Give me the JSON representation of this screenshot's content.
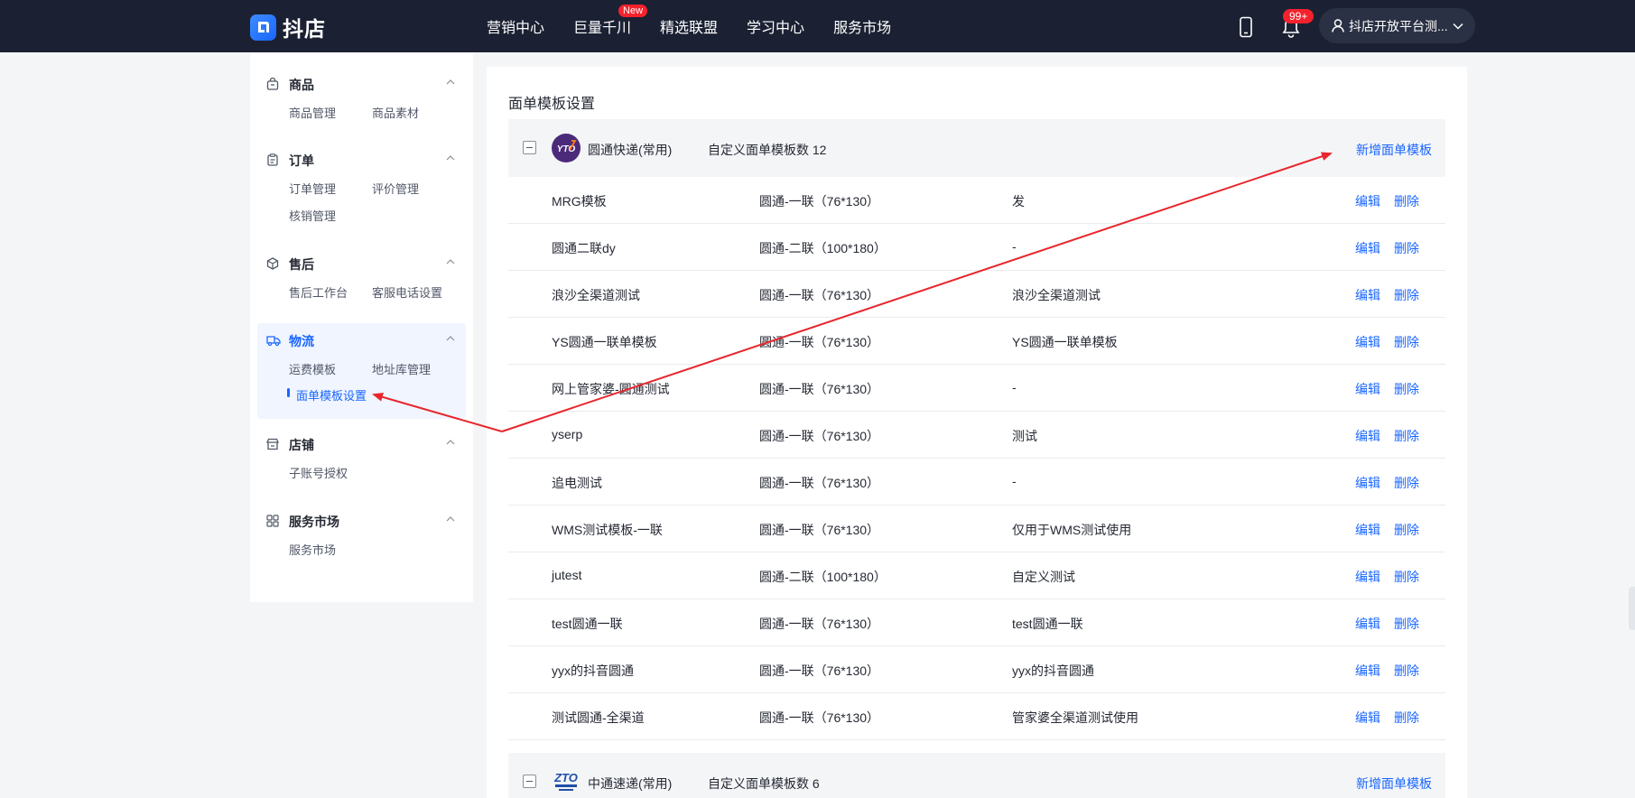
{
  "brand": {
    "name": "抖店"
  },
  "nav": [
    {
      "label": "营销中心"
    },
    {
      "label": "巨量千川",
      "badge": "New"
    },
    {
      "label": "精选联盟"
    },
    {
      "label": "学习中心"
    },
    {
      "label": "服务市场"
    }
  ],
  "header": {
    "bell_badge": "99+",
    "user_name": "抖店开放平台测..."
  },
  "sidebar": {
    "groups": [
      {
        "title": "商品",
        "icon": "bag-icon",
        "items": [
          "商品管理",
          "商品素材"
        ]
      },
      {
        "title": "订单",
        "icon": "clipboard-icon",
        "items": [
          "订单管理",
          "评价管理",
          "核销管理"
        ]
      },
      {
        "title": "售后",
        "icon": "package-icon",
        "items": [
          "售后工作台",
          "客服电话设置"
        ]
      },
      {
        "title": "物流",
        "icon": "truck-icon",
        "items": [
          "运费模板",
          "地址库管理",
          "面单模板设置"
        ],
        "active": true
      },
      {
        "title": "店铺",
        "icon": "store-icon",
        "items": [
          "子账号授权"
        ]
      },
      {
        "title": "服务市场",
        "icon": "grid-icon",
        "items": [
          "服务市场"
        ]
      }
    ]
  },
  "main": {
    "title": "面单模板设置",
    "carriers": [
      {
        "name": "圆通快递(常用)",
        "logo": "YTO",
        "count_label": "自定义面单模板数 12",
        "add_label": "新增面单模板",
        "templates": [
          {
            "name": "MRG模板",
            "type": "圆通-一联（76*130）",
            "remark": "发"
          },
          {
            "name": "圆通二联dy",
            "type": "圆通-二联（100*180）",
            "remark": "-"
          },
          {
            "name": "浪沙全渠道测试",
            "type": "圆通-一联（76*130）",
            "remark": "浪沙全渠道测试"
          },
          {
            "name": "YS圆通一联单模板",
            "type": "圆通-一联（76*130）",
            "remark": "YS圆通一联单模板"
          },
          {
            "name": "网上管家婆-圆通测试",
            "type": "圆通-一联（76*130）",
            "remark": "-"
          },
          {
            "name": "yserp",
            "type": "圆通-一联（76*130）",
            "remark": "测试"
          },
          {
            "name": "追电测试",
            "type": "圆通-一联（76*130）",
            "remark": "-"
          },
          {
            "name": "WMS测试模板-一联",
            "type": "圆通-一联（76*130）",
            "remark": "仅用于WMS测试使用"
          },
          {
            "name": "jutest",
            "type": "圆通-二联（100*180）",
            "remark": "自定义测试"
          },
          {
            "name": "test圆通一联",
            "type": "圆通-一联（76*130）",
            "remark": "test圆通一联"
          },
          {
            "name": "yyx的抖音圆通",
            "type": "圆通-一联（76*130）",
            "remark": "yyx的抖音圆通"
          },
          {
            "name": "测试圆通-全渠道",
            "type": "圆通-一联（76*130）",
            "remark": "管家婆全渠道测试使用"
          }
        ]
      },
      {
        "name": "中通速递(常用)",
        "logo": "ZTO",
        "count_label": "自定义面单模板数 6",
        "add_label": "新增面单模板",
        "templates": []
      }
    ],
    "actions": {
      "edit": "编辑",
      "delete": "删除"
    }
  },
  "colors": {
    "topbar": "#1b2133",
    "accent": "#1966ff",
    "annotation": "#e8262c",
    "badge": "#f5222d"
  }
}
